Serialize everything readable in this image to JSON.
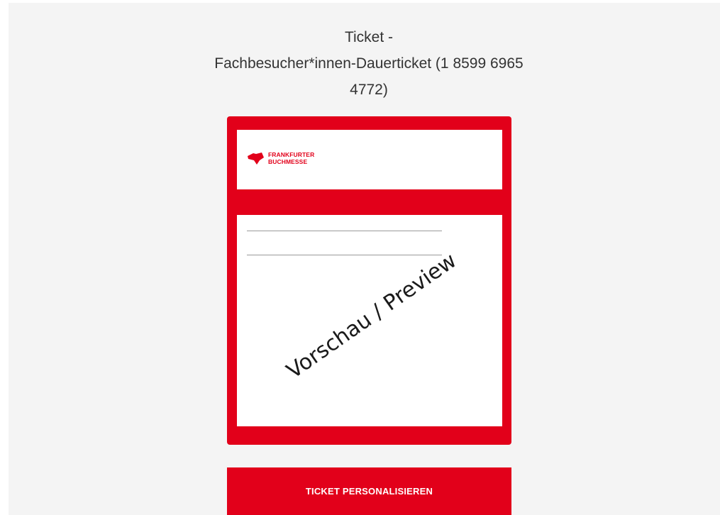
{
  "ticket": {
    "title_line1": "Ticket -",
    "title_line2": "Fachbesucher*innen-Dauerticket (1 8599 6965",
    "title_line3": "4772)"
  },
  "logo": {
    "line1": "FRANKFURTER",
    "line2": "BUCHMESSE",
    "brand_color": "#e2001a"
  },
  "preview": {
    "watermark": "Vorschau / Preview"
  },
  "actions": {
    "personalize_label": "TICKET PERSONALISIEREN"
  },
  "colors": {
    "accent": "#e2001a",
    "background": "#f4f4f4",
    "text": "#333333"
  }
}
